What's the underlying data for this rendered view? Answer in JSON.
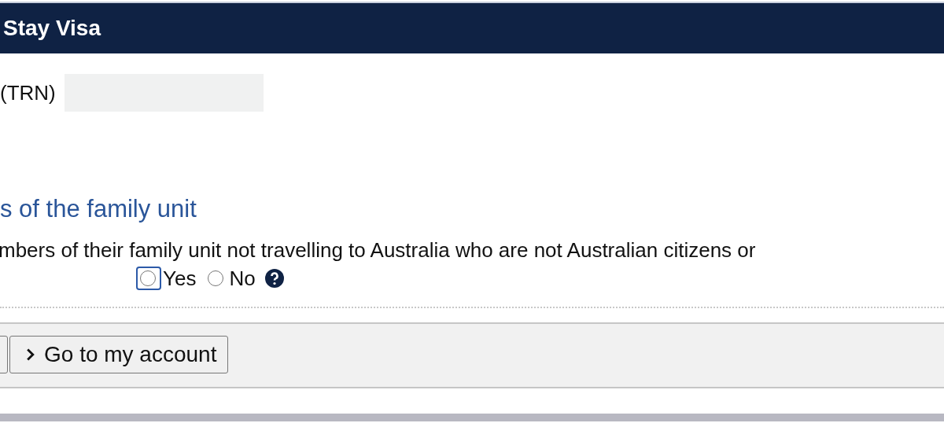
{
  "header": {
    "title": "Stay Visa"
  },
  "trn": {
    "label": "(TRN)"
  },
  "section": {
    "heading": "s of the family unit",
    "question": "mbers of their family unit not travelling to Australia who are not Australian citizens or",
    "options": [
      {
        "label": "Yes",
        "selected": false,
        "focused": true
      },
      {
        "label": "No",
        "selected": false,
        "focused": false
      }
    ]
  },
  "footer": {
    "buttons": [
      {
        "kind": "stub"
      },
      {
        "kind": "labelled",
        "label": "Go to my account"
      }
    ]
  }
}
